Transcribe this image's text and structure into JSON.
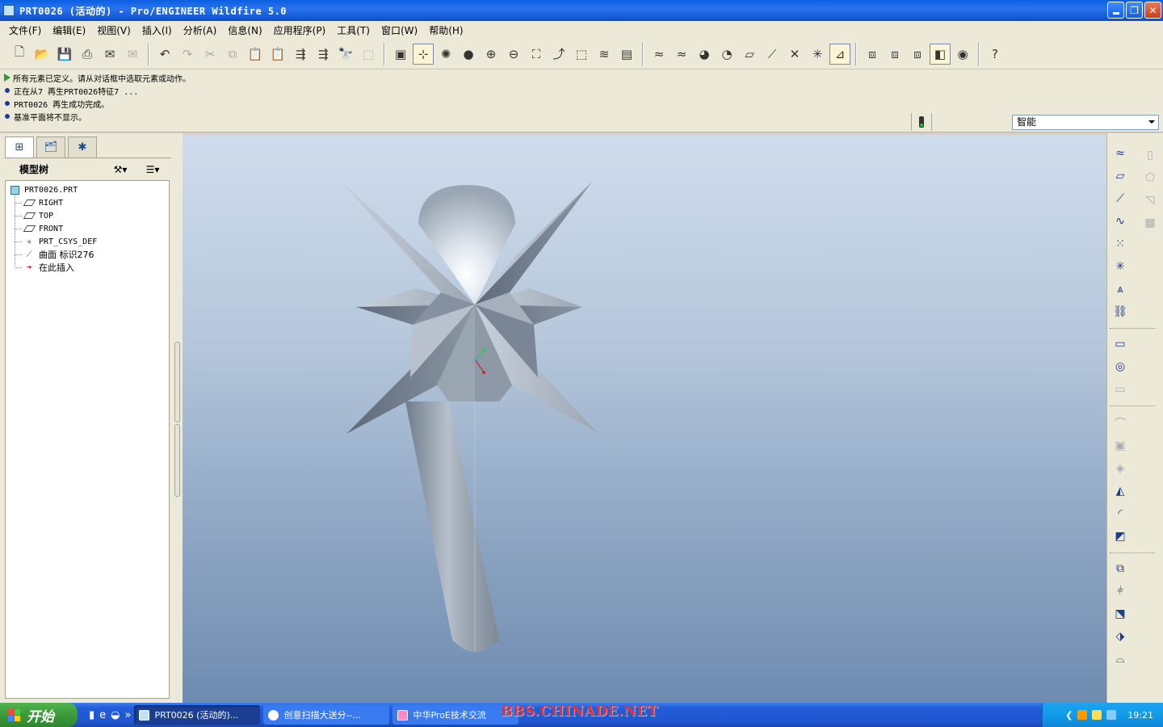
{
  "window": {
    "title": "PRT0026 (活动的) - Pro/ENGINEER Wildfire 5.0",
    "buttons": [
      "minimize",
      "restore",
      "close"
    ]
  },
  "menu": [
    "文件(F)",
    "编辑(E)",
    "视图(V)",
    "插入(I)",
    "分析(A)",
    "信息(N)",
    "应用程序(P)",
    "工具(T)",
    "窗口(W)",
    "帮助(H)"
  ],
  "toolbar": {
    "icons": [
      "new-file-icon",
      "open-folder-icon",
      "save-icon",
      "print-icon",
      "email-icon",
      "email-attach-icon",
      "undo-icon",
      "redo-icon",
      "cut-icon",
      "copy-icon",
      "paste-icon",
      "paste-special-icon",
      "regenerate-icon",
      "regen-manager-icon",
      "find-icon",
      "select-box-icon",
      "repaint-icon",
      "spin-center-icon",
      "orient-mode-icon",
      "shading-icon",
      "zoom-in-icon",
      "zoom-out-icon",
      "refit-icon",
      "reorient-icon",
      "saved-views-icon",
      "layers-icon",
      "view-manager-icon",
      "datum-plane-display-icon",
      "datum-axis-display-icon",
      "point-display-icon",
      "csys-display-icon",
      "wireframe-icon",
      "hidden-line-icon",
      "no-hidden-icon",
      "shaded-icon",
      "enhanced-realism-icon",
      "whats-this-icon"
    ]
  },
  "messages": [
    {
      "type": "prompt",
      "text": "所有元素已定义。请从对话框中选取元素或动作。"
    },
    {
      "type": "info",
      "text": "正在从7 再生PRT0026特征7 ..."
    },
    {
      "type": "info",
      "text": "PRT0026 再生成功完成。"
    },
    {
      "type": "info",
      "text": "基准平面将不显示。"
    }
  ],
  "filter": {
    "selected": "智能"
  },
  "model_tree": {
    "title": "模型树",
    "root": "PRT0026.PRT",
    "items": [
      {
        "label": "RIGHT",
        "icon": "datum-plane-icon"
      },
      {
        "label": "TOP",
        "icon": "datum-plane-icon"
      },
      {
        "label": "FRONT",
        "icon": "datum-plane-icon"
      },
      {
        "label": "PRT_CSYS_DEF",
        "icon": "csys-icon"
      },
      {
        "label": "曲面 标识276",
        "icon": "surface-icon"
      },
      {
        "label": "在此插入",
        "icon": "insert-here-arrow-icon"
      }
    ]
  },
  "taskbar": {
    "start": "开始",
    "tasks": [
      {
        "label": "PRT0026 (活动的)..."
      },
      {
        "label": "创意扫描大送分--..."
      },
      {
        "label": "中华ProE技术交流"
      }
    ],
    "watermark": "BBS.CHINADE.NET",
    "clock": "19:21"
  },
  "colors": {
    "title_bar": "#0a5fe0",
    "taskbar": "#245edb",
    "viewport_top": "#cfdcec",
    "viewport_bottom": "#6e8bb0",
    "model_shade": "#a9b3bf"
  }
}
